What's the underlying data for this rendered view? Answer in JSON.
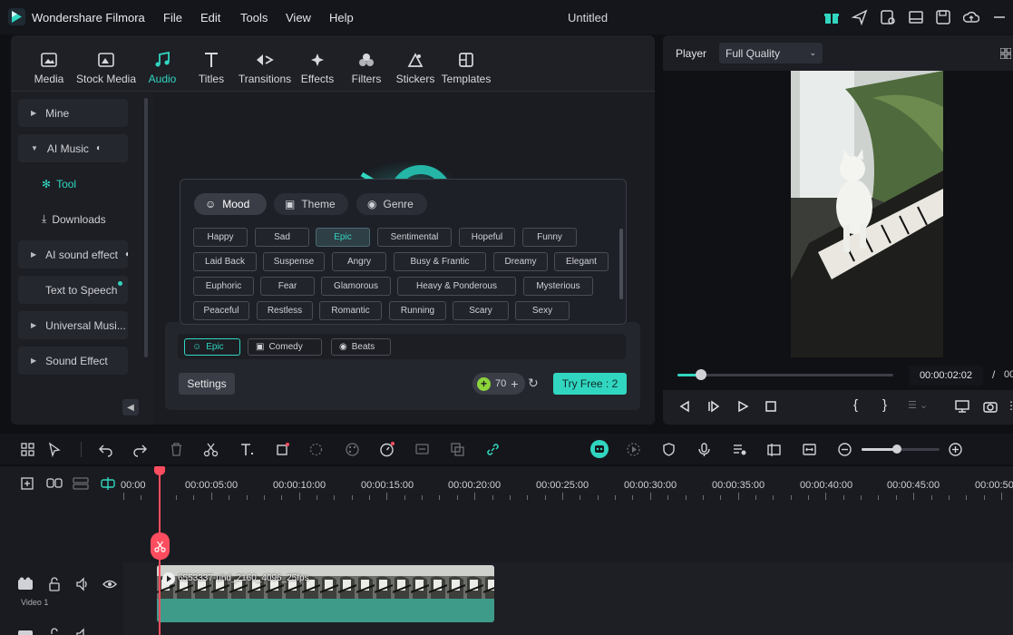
{
  "app": {
    "name": "Wondershare Filmora",
    "doc_title": "Untitled",
    "menu": [
      "File",
      "Edit",
      "Tools",
      "View",
      "Help"
    ]
  },
  "media_tabs": [
    {
      "label": "Media",
      "icon": "media-icon"
    },
    {
      "label": "Stock Media",
      "icon": "stock-media-icon"
    },
    {
      "label": "Audio",
      "icon": "music-note-icon",
      "active": true
    },
    {
      "label": "Titles",
      "icon": "text-T-icon"
    },
    {
      "label": "Transitions",
      "icon": "transitions-icon"
    },
    {
      "label": "Effects",
      "icon": "effects-icon"
    },
    {
      "label": "Filters",
      "icon": "filters-icon"
    },
    {
      "label": "Stickers",
      "icon": "stickers-icon"
    },
    {
      "label": "Templates",
      "icon": "templates-icon"
    }
  ],
  "sidebar": {
    "mine": "Mine",
    "ai_music": "AI Music",
    "tool": "Tool",
    "downloads": "Downloads",
    "ai_sound_effect": "AI sound effect",
    "text_to_speech": "Text to Speech",
    "universal_music": "Universal Musi...",
    "sound_effect": "Sound Effect"
  },
  "ai_music": {
    "tabs": [
      "Mood",
      "Theme",
      "Genre"
    ],
    "moods": [
      [
        "Happy",
        "Sad",
        "Epic",
        "Sentimental",
        "Hopeful",
        "Funny"
      ],
      [
        "Laid Back",
        "Suspense",
        "Angry",
        "Busy & Frantic",
        "Dreamy",
        "Elegant"
      ],
      [
        "Euphoric",
        "Fear",
        "Glamorous",
        "Heavy & Ponderous",
        "Mysterious"
      ],
      [
        "Peaceful",
        "Restless",
        "Romantic",
        "Running",
        "Scary",
        "Sexy"
      ]
    ],
    "selected_mood": "Epic",
    "selection_chips": [
      "Epic",
      "Comedy",
      "Beats"
    ],
    "settings_label": "Settings",
    "credits": "70",
    "try_free": "Try Free : 2"
  },
  "player": {
    "label": "Player",
    "quality": "Full Quality",
    "timecode": "00:00:02:02",
    "timecode_sep": "/",
    "timecode_total": "00",
    "progress_fraction": 0.11
  },
  "timeline": {
    "ruler": [
      "00:00",
      "00:00:05:00",
      "00:00:10:00",
      "00:00:15:00",
      "00:00:20:00",
      "00:00:25:00",
      "00:00:30:00",
      "00:00:35:00",
      "00:00:40:00",
      "00:00:45:00",
      "00:00:50"
    ],
    "clip_name": "6553337-uhd_2160_4096_25fps",
    "track_label": "Video 1",
    "zoom_fraction": 0.45
  },
  "colors": {
    "accent": "#31d6c1",
    "playhead": "#ff4d5f",
    "try_free_bg": "#31d6c1",
    "audio_wave_bg": "#3e9b8a"
  }
}
